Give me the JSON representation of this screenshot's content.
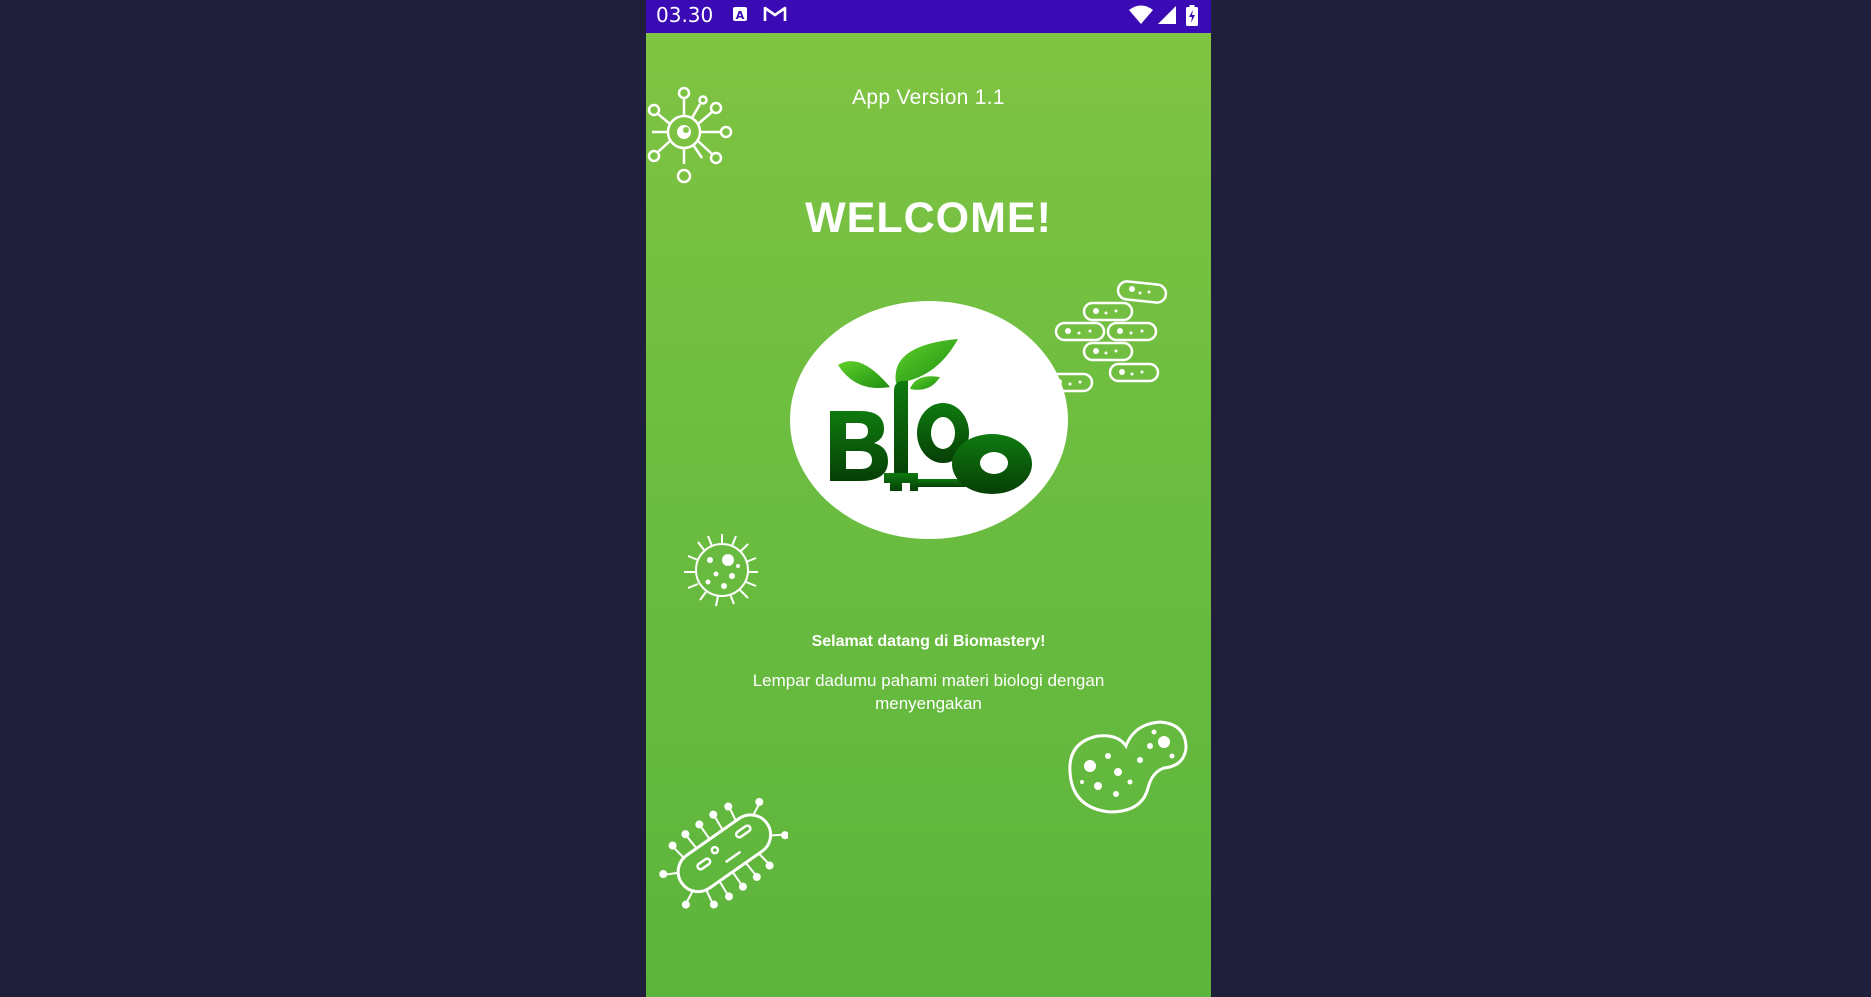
{
  "status_bar": {
    "time": "03.30",
    "icons": [
      "a-box-icon",
      "gmail-icon",
      "wifi-icon",
      "signal-icon",
      "battery-charging-icon"
    ],
    "background": "#3a0ab5"
  },
  "app": {
    "version_label": "App Version 1.1",
    "welcome_title": "WELCOME!",
    "logo_text": "BIO",
    "welcome_heading": "Selamat datang di Biomastery!",
    "welcome_description": "Lempar dadumu pahami materi biologi dengan menyengakan"
  },
  "colors": {
    "background_top": "#82c443",
    "background_bottom": "#5db53c",
    "logo_dark_green": "#0a5a0a",
    "logo_leaf_green": "#3cb01e"
  },
  "decorations": [
    "virus-icon",
    "bacteria-chain-icon",
    "germ-icon",
    "cell-icon",
    "bacillus-icon"
  ]
}
